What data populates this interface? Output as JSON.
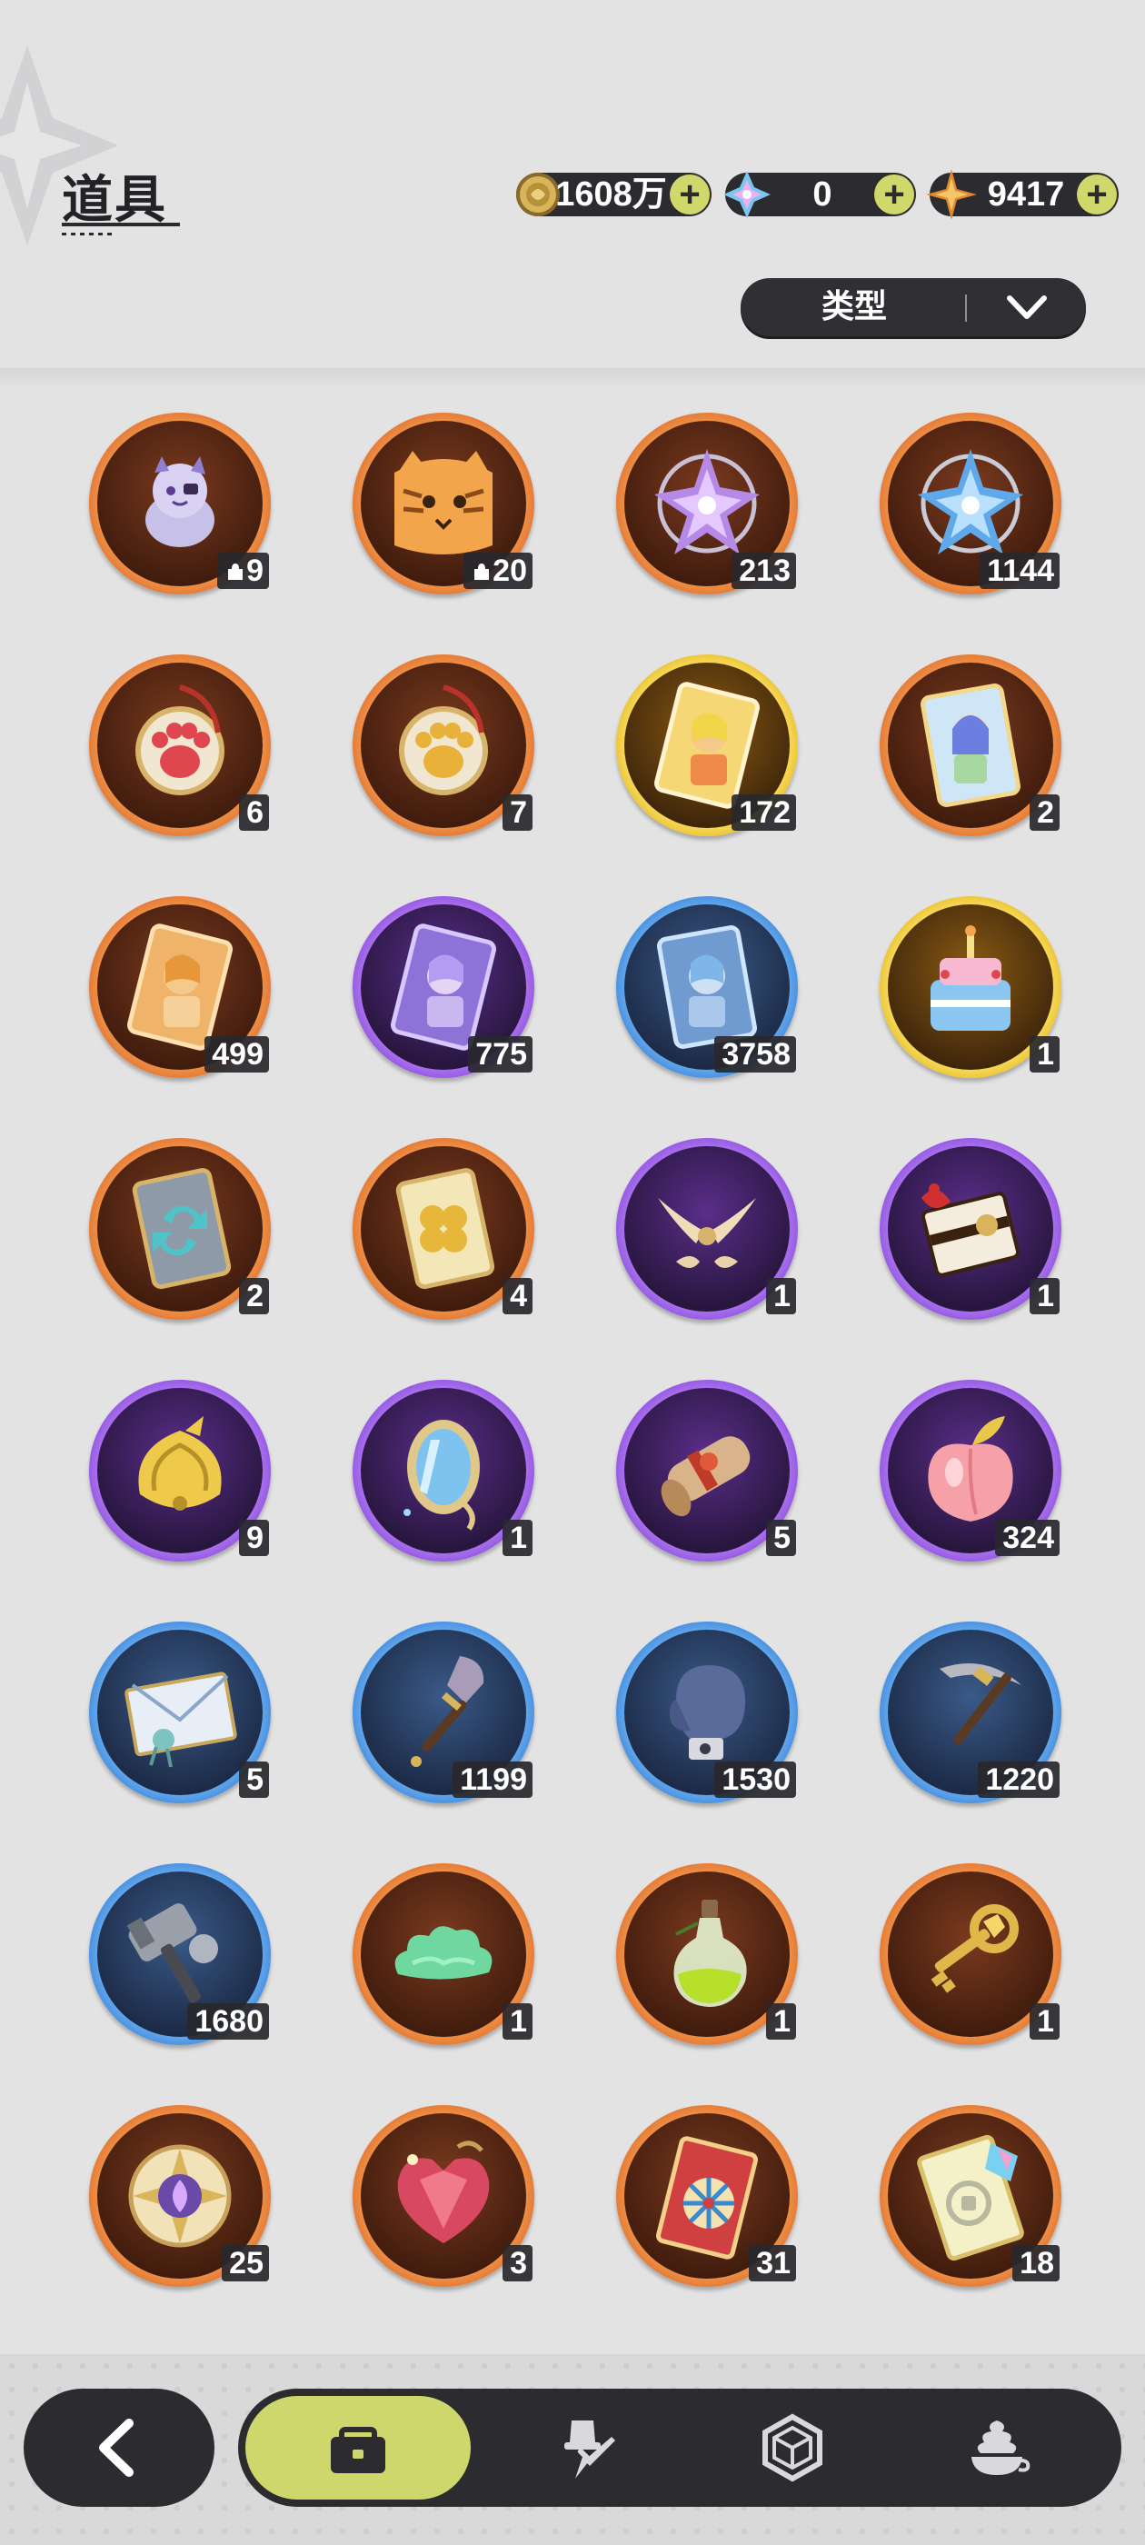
{
  "header": {
    "title": "道具"
  },
  "currencies": [
    {
      "name": "coin-icon",
      "value": "1608万",
      "color": "#c9a64a"
    },
    {
      "name": "crystal-icon",
      "value": "0",
      "color": "#9fd6f0"
    },
    {
      "name": "star-shard-icon",
      "value": "9417",
      "color": "#e79b3a"
    }
  ],
  "filter": {
    "label": "类型",
    "icon": "chevron-down-icon"
  },
  "items": [
    {
      "icon": "cat-puppet-fragment-icon",
      "rarity": "orange",
      "qty": "9",
      "fragment": true
    },
    {
      "icon": "tiger-cat-fragment-icon",
      "rarity": "orange",
      "qty": "20",
      "fragment": true
    },
    {
      "icon": "purple-crystal-icon",
      "rarity": "orange",
      "qty": "213"
    },
    {
      "icon": "blue-crystal-icon",
      "rarity": "orange",
      "qty": "1144"
    },
    {
      "icon": "red-paw-charm-icon",
      "rarity": "orange",
      "qty": "6"
    },
    {
      "icon": "gold-paw-charm-icon",
      "rarity": "orange",
      "qty": "7"
    },
    {
      "icon": "gold-character-card-icon",
      "rarity": "gold",
      "qty": "172"
    },
    {
      "icon": "rainbow-character-card-icon",
      "rarity": "orange",
      "qty": "2"
    },
    {
      "icon": "orange-character-card-icon",
      "rarity": "orange",
      "qty": "499"
    },
    {
      "icon": "purple-character-card-icon",
      "rarity": "purple",
      "qty": "775"
    },
    {
      "icon": "blue-character-card-icon",
      "rarity": "blue",
      "qty": "3758"
    },
    {
      "icon": "birthday-cake-icon",
      "rarity": "gold",
      "qty": "1"
    },
    {
      "icon": "swap-card-icon",
      "rarity": "orange",
      "qty": "2"
    },
    {
      "icon": "clover-card-icon",
      "rarity": "orange",
      "qty": "4"
    },
    {
      "icon": "horn-ornament-icon",
      "rarity": "purple",
      "qty": "1"
    },
    {
      "icon": "gift-box-icon",
      "rarity": "purple",
      "qty": "1"
    },
    {
      "icon": "golden-bell-icon",
      "rarity": "purple",
      "qty": "9"
    },
    {
      "icon": "magic-mirror-icon",
      "rarity": "purple",
      "qty": "1"
    },
    {
      "icon": "scroll-icon",
      "rarity": "purple",
      "qty": "5"
    },
    {
      "icon": "peach-icon",
      "rarity": "purple",
      "qty": "324"
    },
    {
      "icon": "letter-envelope-icon",
      "rarity": "blue",
      "qty": "5"
    },
    {
      "icon": "shovel-icon",
      "rarity": "blue",
      "qty": "1199"
    },
    {
      "icon": "boxing-glove-icon",
      "rarity": "blue",
      "qty": "1530"
    },
    {
      "icon": "pickaxe-icon",
      "rarity": "blue",
      "qty": "1220"
    },
    {
      "icon": "hammer-icon",
      "rarity": "blue",
      "qty": "1680"
    },
    {
      "icon": "jade-cloud-icon",
      "rarity": "orange",
      "qty": "1"
    },
    {
      "icon": "potion-bottle-icon",
      "rarity": "orange",
      "qty": "1"
    },
    {
      "icon": "golden-key-icon",
      "rarity": "orange",
      "qty": "1"
    },
    {
      "icon": "emblem-medal-icon",
      "rarity": "orange",
      "qty": "25"
    },
    {
      "icon": "ruby-heart-icon",
      "rarity": "orange",
      "qty": "3"
    },
    {
      "icon": "wheel-ticket-icon",
      "rarity": "orange",
      "qty": "31"
    },
    {
      "icon": "puzzle-ticket-icon",
      "rarity": "orange",
      "qty": "18"
    }
  ],
  "nav": {
    "back_icon": "back-arrow-icon",
    "tabs": [
      {
        "icon": "bag-icon",
        "active": true
      },
      {
        "icon": "hat-sword-icon",
        "active": false
      },
      {
        "icon": "hexagon-gem-icon",
        "active": false
      },
      {
        "icon": "dessert-icon",
        "active": false
      }
    ]
  }
}
